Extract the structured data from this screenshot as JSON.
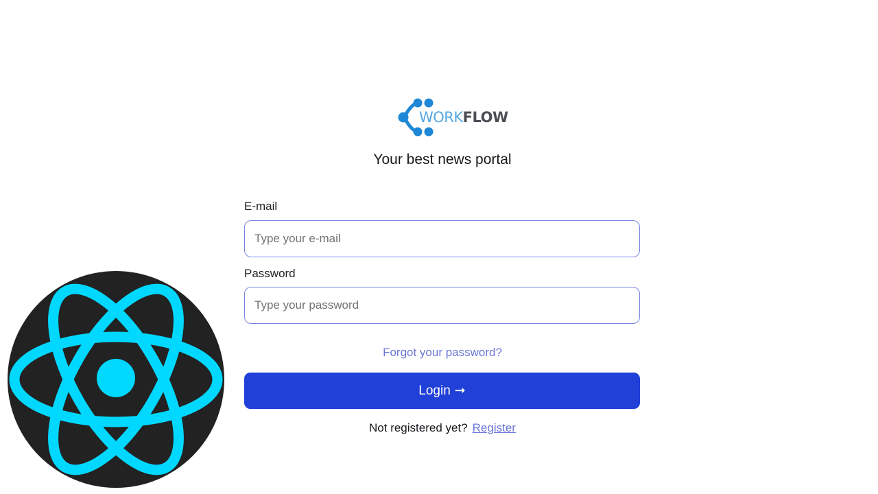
{
  "brand": {
    "word_light": "WORK",
    "word_bold": "FLOW",
    "colors": {
      "dots": "#1e88d6",
      "light_text": "#56a6e0",
      "dark_text": "#4b4f55"
    }
  },
  "tagline": "Your best news portal",
  "form": {
    "email": {
      "label": "E-mail",
      "value": "",
      "placeholder": "Type your e-mail"
    },
    "password": {
      "label": "Password",
      "value": "",
      "placeholder": "Type your password"
    },
    "forgot_link": "Forgot your password?",
    "login_button": {
      "label": "Login",
      "icon": "arrow-right-icon",
      "arrow_glyph": "➞"
    },
    "register": {
      "prompt": "Not registered yet?",
      "link": "Register"
    }
  },
  "overlay": {
    "icon": "react-logo-icon",
    "colors": {
      "background": "#222222",
      "accent": "#00d8ff"
    }
  },
  "theme": {
    "primary": "#2040d8",
    "link": "#6b77d8",
    "input_border": "#7b86e4"
  }
}
